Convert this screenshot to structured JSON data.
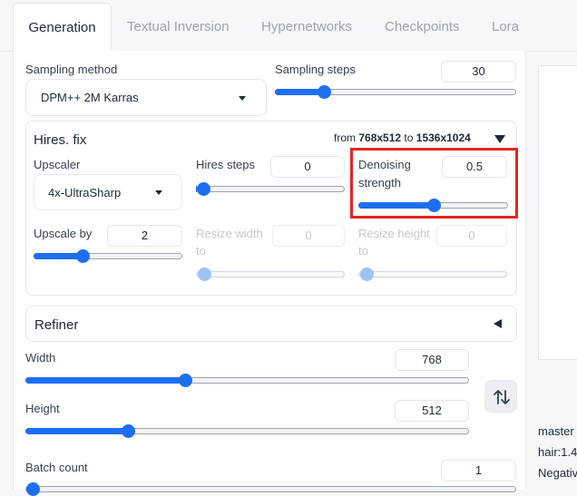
{
  "tabs": [
    {
      "label": "Generation",
      "active": true
    },
    {
      "label": "Textual Inversion",
      "active": false
    },
    {
      "label": "Hypernetworks",
      "active": false
    },
    {
      "label": "Checkpoints",
      "active": false
    },
    {
      "label": "Lora",
      "active": false
    }
  ],
  "sampling": {
    "method_label": "Sampling method",
    "method_value": "DPM++ 2M Karras",
    "steps_label": "Sampling steps",
    "steps_value": "30",
    "steps_fraction": 0.2
  },
  "hires": {
    "title": "Hires. fix",
    "from_prefix": "from",
    "from_res": "768x512",
    "to_prefix": "to",
    "to_res": "1536x1024",
    "expanded": true,
    "upscaler_label": "Upscaler",
    "upscaler_value": "4x-UltraSharp",
    "hires_steps_label": "Hires steps",
    "hires_steps_value": "0",
    "hires_steps_fraction": 0.0,
    "denoising_label_line1": "Denoising",
    "denoising_label_line2": "strength",
    "denoising_value": "0.5",
    "denoising_fraction": 0.5,
    "upscale_by_label": "Upscale by",
    "upscale_by_value": "2",
    "upscale_by_fraction": 0.33,
    "resize_width_label_line1": "Resize width",
    "resize_width_label_line2": "to",
    "resize_width_value": "0",
    "resize_height_label_line1": "Resize height",
    "resize_height_label_line2": "to",
    "resize_height_value": "0"
  },
  "refiner": {
    "title": "Refiner",
    "expanded": false
  },
  "dimensions": {
    "width_label": "Width",
    "width_value": "768",
    "width_fraction": 0.36,
    "height_label": "Height",
    "height_value": "512",
    "height_fraction": 0.23,
    "swap_icon": "swap-dimensions-icon"
  },
  "batch": {
    "count_label": "Batch count",
    "count_value": "1"
  },
  "right_panel": {
    "line1": "master",
    "line2": "hair:1.4",
    "line3": "Negativ"
  },
  "colors": {
    "accent": "#1d6ff2",
    "highlight": "#e3261f"
  }
}
